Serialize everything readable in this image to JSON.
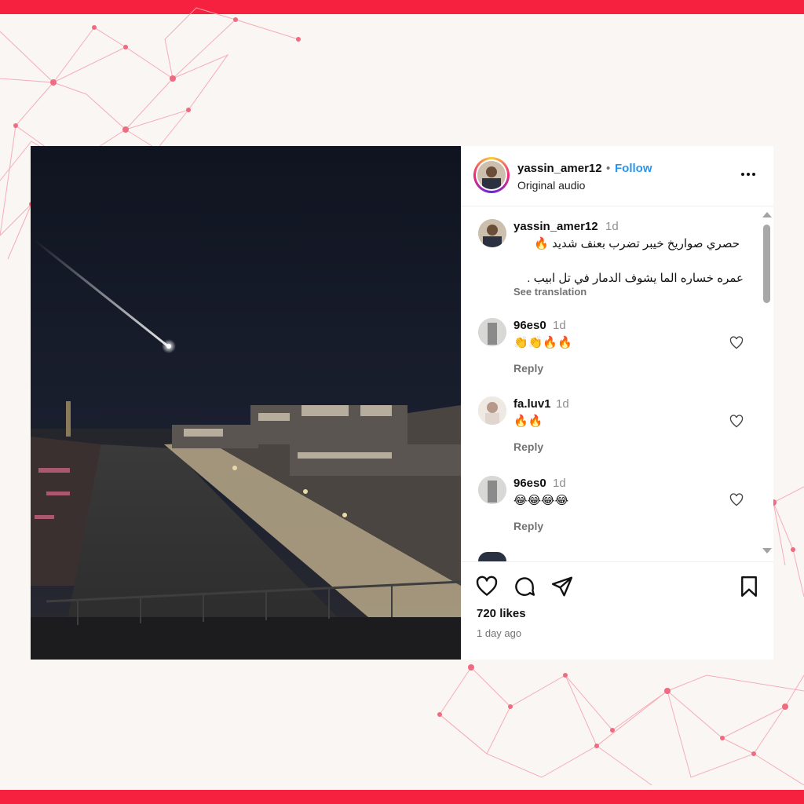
{
  "colors": {
    "accent_bar": "#f5213f",
    "follow": "#2c94e8",
    "network_line": "#f28a97"
  },
  "post": {
    "author": {
      "username": "yassin_amer12",
      "separator": "•",
      "follow_label": "Follow",
      "audio_label": "Original audio"
    },
    "caption": {
      "username": "yassin_amer12",
      "time": "1d",
      "line1": "حصري صواريخ خيبر تضرب بعنف شديد 🔥",
      "line2": "عمره خساره الما يشوف الدمار في تل ابيب .",
      "see_translation": "See translation"
    },
    "comments": [
      {
        "username": "96es0",
        "time": "1d",
        "text": "👏👏🔥🔥",
        "reply_label": "Reply"
      },
      {
        "username": "fa.luv1",
        "time": "1d",
        "text": "🔥🔥",
        "reply_label": "Reply"
      },
      {
        "username": "96es0",
        "time": "1d",
        "text": "😂😂😂😂",
        "reply_label": "Reply"
      }
    ],
    "likes": "720 likes",
    "date": "1 day ago"
  },
  "icons": [
    "more-options-icon",
    "heart-icon",
    "comment-icon",
    "share-icon",
    "bookmark-icon"
  ]
}
